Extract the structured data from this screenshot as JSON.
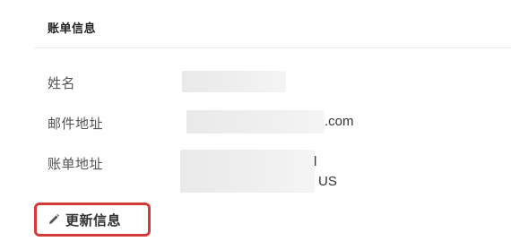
{
  "billing": {
    "title": "账单信息",
    "name_label": "姓名",
    "email_label": "邮件地址",
    "email_suffix": ".com",
    "address_label": "账单地址",
    "address_line1_suffix": "l",
    "address_country": "US"
  },
  "actions": {
    "update_label": "更新信息",
    "update_icon": "pencil-icon"
  },
  "colors": {
    "highlight_border": "#d43a3a",
    "redacted_fill": "#ececec"
  }
}
